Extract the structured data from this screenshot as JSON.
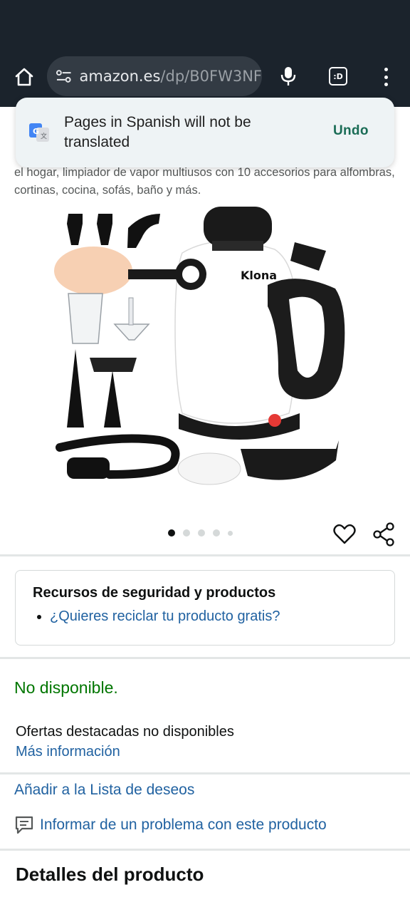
{
  "browser": {
    "url_domain": "amazon.es",
    "url_path": "/dp/B0FW3NF",
    "tabs_label": ":D"
  },
  "translate_popup": {
    "message": "Pages in Spanish will not be translated",
    "undo_label": "Undo"
  },
  "product": {
    "title_partial": "el hogar, limpiador de vapor multiusos con 10 accesorios para alfombras, cortinas, cocina, sofás, baño y más.",
    "image_brand": "Klona",
    "carousel": {
      "count": 5,
      "active": 1
    }
  },
  "safety": {
    "title": "Recursos de seguridad y productos",
    "link": "¿Quieres reciclar tu producto gratis?"
  },
  "availability": {
    "status": "No disponible.",
    "offers": "Ofertas destacadas no disponibles",
    "more_info": "Más información"
  },
  "actions": {
    "wishlist": "Añadir a la Lista de deseos",
    "report": "Informar de un problema con este producto"
  },
  "details": {
    "title": "Detalles del producto"
  },
  "colors": {
    "chrome_bg": "#1b232c",
    "link": "#2162a1",
    "available_green": "#007600",
    "undo_green": "#1a6c56"
  }
}
